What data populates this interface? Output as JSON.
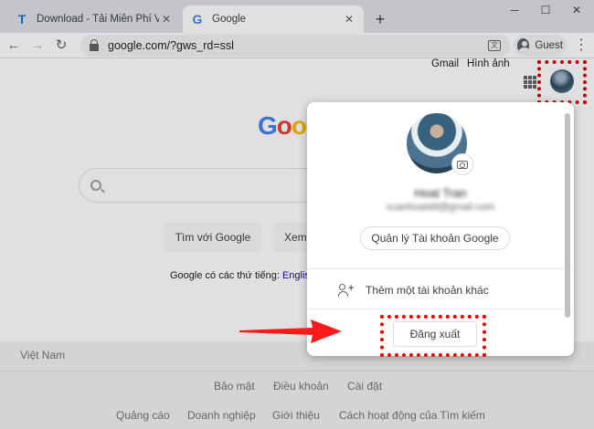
{
  "browser": {
    "tabs": [
      {
        "title": "Download - Tải Miễn Phí VN - Ph",
        "icon": "T",
        "active": false
      },
      {
        "title": "Google",
        "icon": "G",
        "active": true
      }
    ],
    "url": "google.com/?gws_rd=ssl",
    "profile_label": "Guest"
  },
  "header": {
    "gmail_label": "Gmail",
    "images_label": "Hình ảnh"
  },
  "main": {
    "logo_letters": [
      "G",
      "o",
      "o"
    ],
    "search_button_label": "Tìm với Google",
    "second_button_label": "Xem",
    "lang_prefix": "Google có các thứ tiếng:",
    "lang_link": "Englis"
  },
  "footer": {
    "country": "Việt Nam",
    "row1": [
      "Bảo mật",
      "Điều khoản",
      "Cài đặt"
    ],
    "row2": [
      "Quảng cáo",
      "Doanh nghiệp",
      "Giới thiệu",
      "Cách hoạt động của Tìm kiếm"
    ]
  },
  "account_popup": {
    "name": "Hoat Tran",
    "email": "xuanhoatdd@gmail.com",
    "manage_label": "Quản lý Tài khoản Google",
    "add_account_label": "Thêm một tài khoản khác",
    "signout_label": "Đăng xuất"
  },
  "colors": {
    "highlight": "#e00000",
    "arrow": "#ff1a1a",
    "link": "#1a0dab"
  }
}
